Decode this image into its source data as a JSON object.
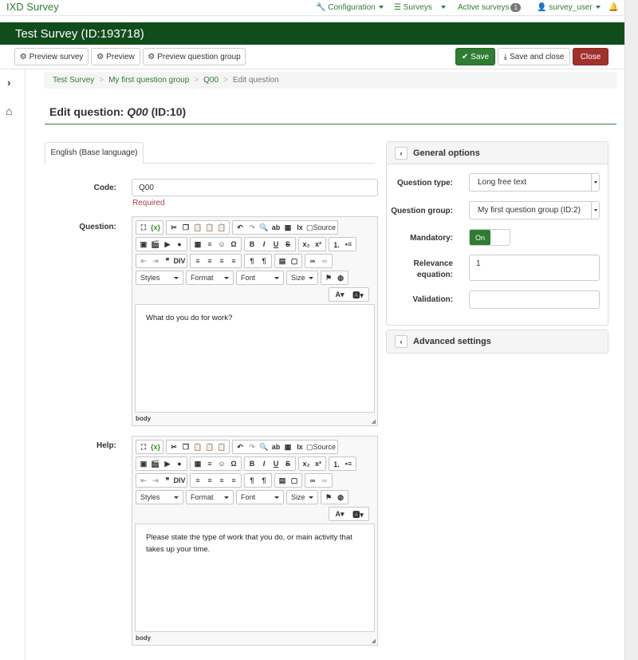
{
  "brand": "IXD Survey",
  "nav": {
    "configuration": "Configuration",
    "surveys": "Surveys",
    "active_surveys": "Active surveys",
    "active_count": "1",
    "user": "survey_user"
  },
  "survey_title": "Test Survey (ID:193718)",
  "toolbar": {
    "preview_survey": "Preview survey",
    "preview": "Preview",
    "preview_group": "Preview question group",
    "save": "Save",
    "save_close": "Save and close",
    "close": "Close"
  },
  "breadcrumb": [
    "Test Survey",
    "My first question group",
    "Q00",
    "Edit question"
  ],
  "page_title": {
    "prefix": "Edit question: ",
    "code": "Q00",
    "suffix": " (ID:10)"
  },
  "language_tab": "English (Base language)",
  "form": {
    "code_label": "Code:",
    "code_value": "Q00",
    "required": "Required",
    "question_label": "Question:",
    "question_text": "What do you do for work?",
    "help_label": "Help:",
    "help_text": "Please state the type of work that you do, or main activity that takes up your time."
  },
  "editor": {
    "source": "Source",
    "styles": "Styles",
    "format": "Format",
    "font": "Font",
    "size": "Size",
    "footer": "body"
  },
  "general": {
    "title": "General options",
    "type_label": "Question type:",
    "type_value": "Long free text",
    "group_label": "Question group:",
    "group_value": "My first question group (ID:2)",
    "mandatory_label": "Mandatory:",
    "mandatory_value": "On",
    "relevance_label": "Relevance equation:",
    "relevance_value": "1",
    "validation_label": "Validation:",
    "validation_value": ""
  },
  "advanced": {
    "title": "Advanced settings"
  },
  "colors": {
    "accent": "#2e7d32",
    "header": "#114d1b",
    "close": "#a0312b"
  }
}
